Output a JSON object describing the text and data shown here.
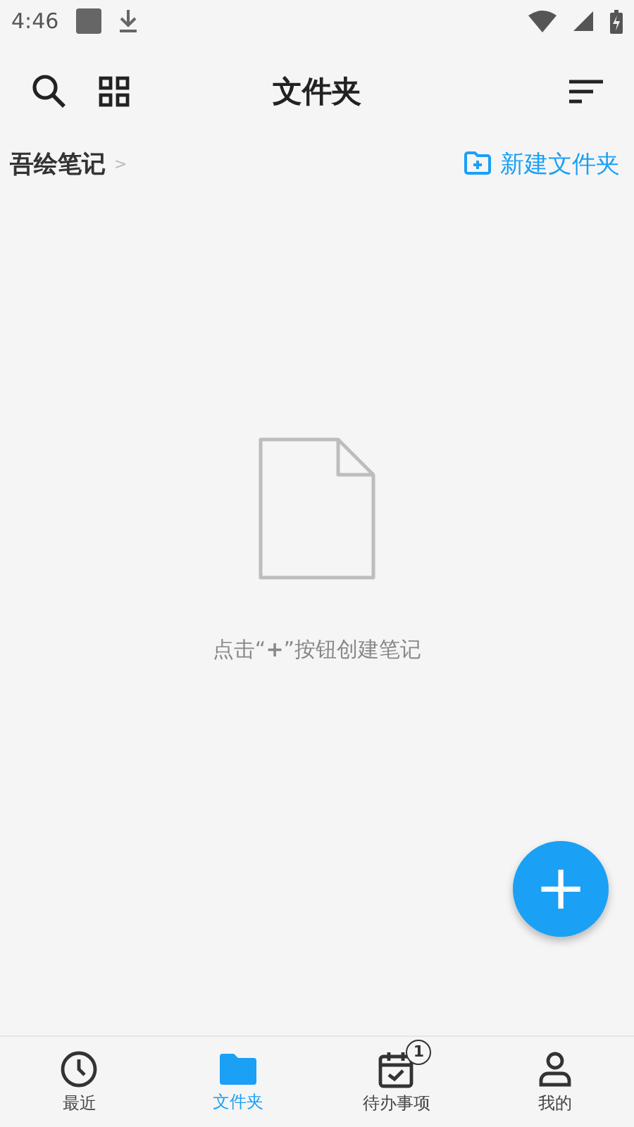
{
  "status_bar": {
    "time": "4:46"
  },
  "top_bar": {
    "title": "文件夹"
  },
  "breadcrumb": {
    "items": [
      "吾绘笔记"
    ],
    "separator": ">"
  },
  "new_folder_button": {
    "label": "新建文件夹"
  },
  "empty_state": {
    "hint": "点击“**+**”按钮创建笔记"
  },
  "fab": {
    "label": "+"
  },
  "bottom_nav": [
    {
      "kind": "recent",
      "label": "最近",
      "selected": false
    },
    {
      "kind": "folder",
      "label": "文件夹",
      "selected": true
    },
    {
      "kind": "todo",
      "label": "待办事项",
      "selected": false,
      "badge": "1"
    },
    {
      "kind": "profile",
      "label": "我的",
      "selected": false
    }
  ]
}
